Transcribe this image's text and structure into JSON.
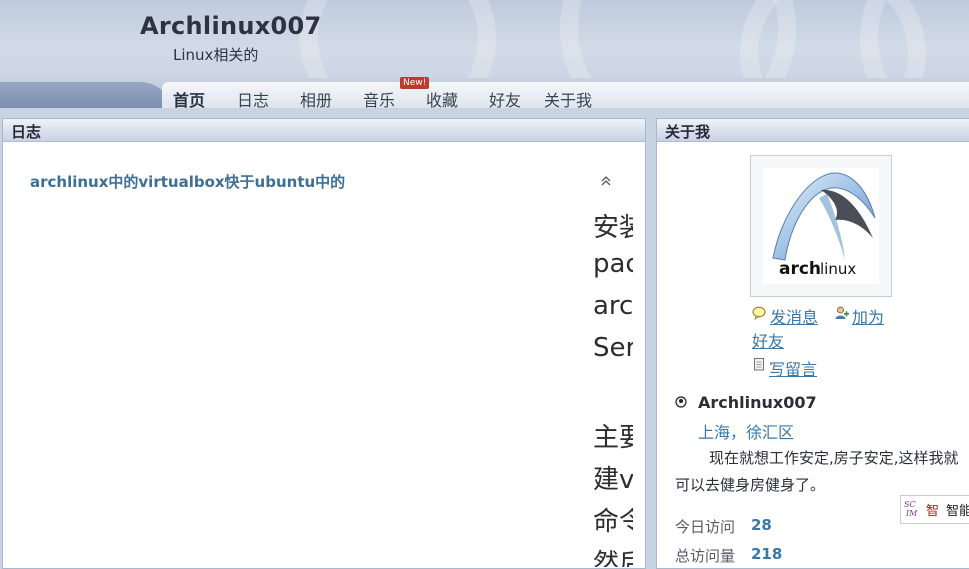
{
  "site": {
    "title": "Archlinux007",
    "subtitle": "Linux相关的"
  },
  "nav": {
    "tabs": [
      {
        "label": "首页",
        "active": true
      },
      {
        "label": "日志",
        "active": false
      },
      {
        "label": "相册",
        "active": false
      },
      {
        "label": "音乐",
        "active": false
      },
      {
        "label": "收藏",
        "active": false
      },
      {
        "label": "好友",
        "active": false
      },
      {
        "label": "关于我",
        "active": false
      }
    ],
    "badge": "New!"
  },
  "blog_panel": {
    "title": "日志",
    "post_title": "archlinux中的virtualbox快于ubuntu中的",
    "post_lines": [
      "安装",
      "pac",
      "arc",
      "Ser",
      "",
      "主要",
      "建v",
      "命令",
      "然后"
    ]
  },
  "about_panel": {
    "title": "关于我",
    "avatar_logo_text": {
      "bold": "arch",
      "light": "linux"
    },
    "actions": {
      "message": "发消息",
      "add_friend": "加为",
      "add_friend_line2": "好友",
      "guestbook": "写留言"
    },
    "user": {
      "name": "Archlinux007",
      "location": "上海，徐汇区",
      "bio": "现在就想工作安定,房子安定,这样我就可以去健身房健身了。"
    },
    "stats": [
      {
        "label": "今日访问",
        "value": "28"
      },
      {
        "label": "总访问量",
        "value": "218"
      }
    ]
  },
  "widget": {
    "glyph": "智",
    "label": "智能"
  },
  "colors": {
    "link": "#3a78a8",
    "header_bg": "#c3cedf",
    "badge": "#c0392b"
  }
}
